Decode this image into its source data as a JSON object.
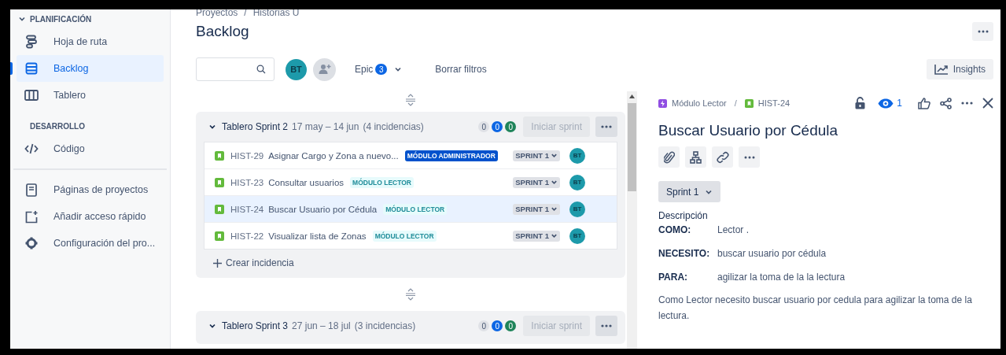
{
  "sidebar": {
    "sections": [
      {
        "title": "PLANIFICACIÓN",
        "expanded": true,
        "items": [
          {
            "label": "Hoja de ruta",
            "selected": false
          },
          {
            "label": "Backlog",
            "selected": true
          },
          {
            "label": "Tablero",
            "selected": false
          }
        ]
      },
      {
        "title": "DESARROLLO",
        "items": [
          {
            "label": "Código",
            "selected": false
          }
        ]
      }
    ],
    "footer_items": [
      {
        "label": "Páginas de proyectos"
      },
      {
        "label": "Añadir acceso rápido"
      },
      {
        "label": "Configuración del pro..."
      }
    ]
  },
  "breadcrumb": [
    "Proyectos",
    "Historias U"
  ],
  "breadcrumb_separator": "/",
  "page_title": "Backlog",
  "toolbar": {
    "assignee": "BT",
    "epic": {
      "label": "Epic",
      "count": "3"
    },
    "clear": "Borrar filtros",
    "insights": "Insights"
  },
  "sprints": [
    {
      "name": "Tablero Sprint 2",
      "dates": "17 may – 14 jun",
      "count": "(4 incidencias)",
      "expanded": true,
      "badges": [
        {
          "value": "0",
          "color": "#dfe1e6"
        },
        {
          "value": "0",
          "color": "#0c66e4"
        },
        {
          "value": "0",
          "color": "#1f845a"
        }
      ],
      "start": "Iniciar sprint",
      "create": "Crear incidencia",
      "issues": [
        {
          "key": "HIST-29",
          "summary": "Asignar Cargo y Zona a nuevo...",
          "epic": {
            "label": "MÓDULO ADMINISTRADOR",
            "kind": "strong"
          },
          "sprint": "SPRINT 1",
          "assignee": "BT",
          "selected": false
        },
        {
          "key": "HIST-23",
          "summary": "Consultar usuarios",
          "epic": {
            "label": "MÓDULO LECTOR",
            "kind": "subtle"
          },
          "sprint": "SPRINT 1",
          "assignee": "BT",
          "selected": false
        },
        {
          "key": "HIST-24",
          "summary": "Buscar Usuario por Cédula",
          "epic": {
            "label": "MÓDULO LECTOR",
            "kind": "subtle"
          },
          "sprint": "SPRINT 1",
          "assignee": "BT",
          "selected": true
        },
        {
          "key": "HIST-22",
          "summary": "Visualizar lista de Zonas",
          "epic": {
            "label": "MÓDULO LECTOR",
            "kind": "subtle"
          },
          "sprint": "SPRINT 1",
          "assignee": "BT",
          "selected": false
        }
      ]
    },
    {
      "name": "Tablero Sprint 3",
      "dates": "27 jun – 18 jul",
      "count": "(3 incidencias)",
      "expanded": true,
      "badges": [
        {
          "value": "0",
          "color": "#dfe1e6"
        },
        {
          "value": "0",
          "color": "#0c66e4"
        },
        {
          "value": "0",
          "color": "#1f845a"
        }
      ],
      "start": "Iniciar sprint"
    }
  ],
  "detail": {
    "epic": "Módulo Lector",
    "separator": "/",
    "key": "HIST-24",
    "watchers": "1",
    "title": "Buscar Usuario por Cédula",
    "sprint": "Sprint 1",
    "description_label": "Descripción",
    "fields": [
      {
        "label": "COMO:",
        "value": "Lector ."
      },
      {
        "label": "NECESITO:",
        "value": "buscar usuario por cédula"
      },
      {
        "label": "PARA:",
        "value": "agilizar la toma de la la lectura"
      }
    ],
    "paragraph": "Como Lector necesito buscar usuario por cedula para  agilizar la toma de la lectura."
  }
}
